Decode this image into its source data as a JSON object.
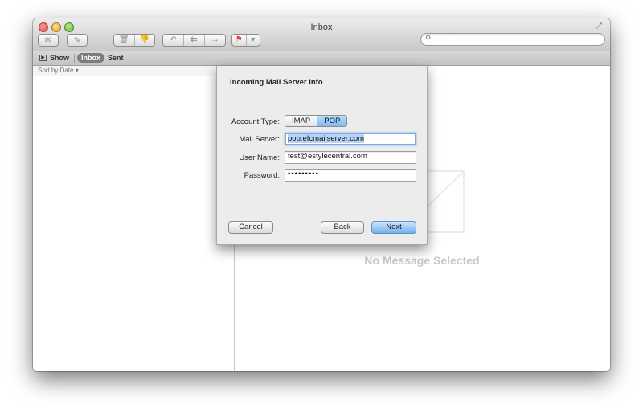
{
  "window": {
    "title": "Inbox"
  },
  "toolbar": {
    "buttons": [
      "get-mail",
      "compose",
      "delete",
      "junk",
      "reply",
      "reply-all",
      "forward",
      "flag"
    ]
  },
  "favorites_bar": {
    "show_label": "Show",
    "inbox_label": "Inbox",
    "sent_label": "Sent"
  },
  "message_list": {
    "sort_label": "Sort by Date ▾"
  },
  "viewer": {
    "empty_text": "No Message Selected"
  },
  "dialog": {
    "title": "Incoming Mail Server Info",
    "account_type_label": "Account Type:",
    "account_type_options": [
      "IMAP",
      "POP"
    ],
    "account_type_selected": "POP",
    "mail_server_label": "Mail Server:",
    "mail_server_value": "pop.efcmailserver.com",
    "user_name_label": "User Name:",
    "user_name_value": "test@estylecentral.com",
    "password_label": "Password:",
    "password_value": "•••••••••",
    "cancel_label": "Cancel",
    "back_label": "Back",
    "next_label": "Next"
  },
  "colors": {
    "accent": "#7fbaf1",
    "focus_ring": "#7aa9e6",
    "selection": "#b6d4f7"
  }
}
